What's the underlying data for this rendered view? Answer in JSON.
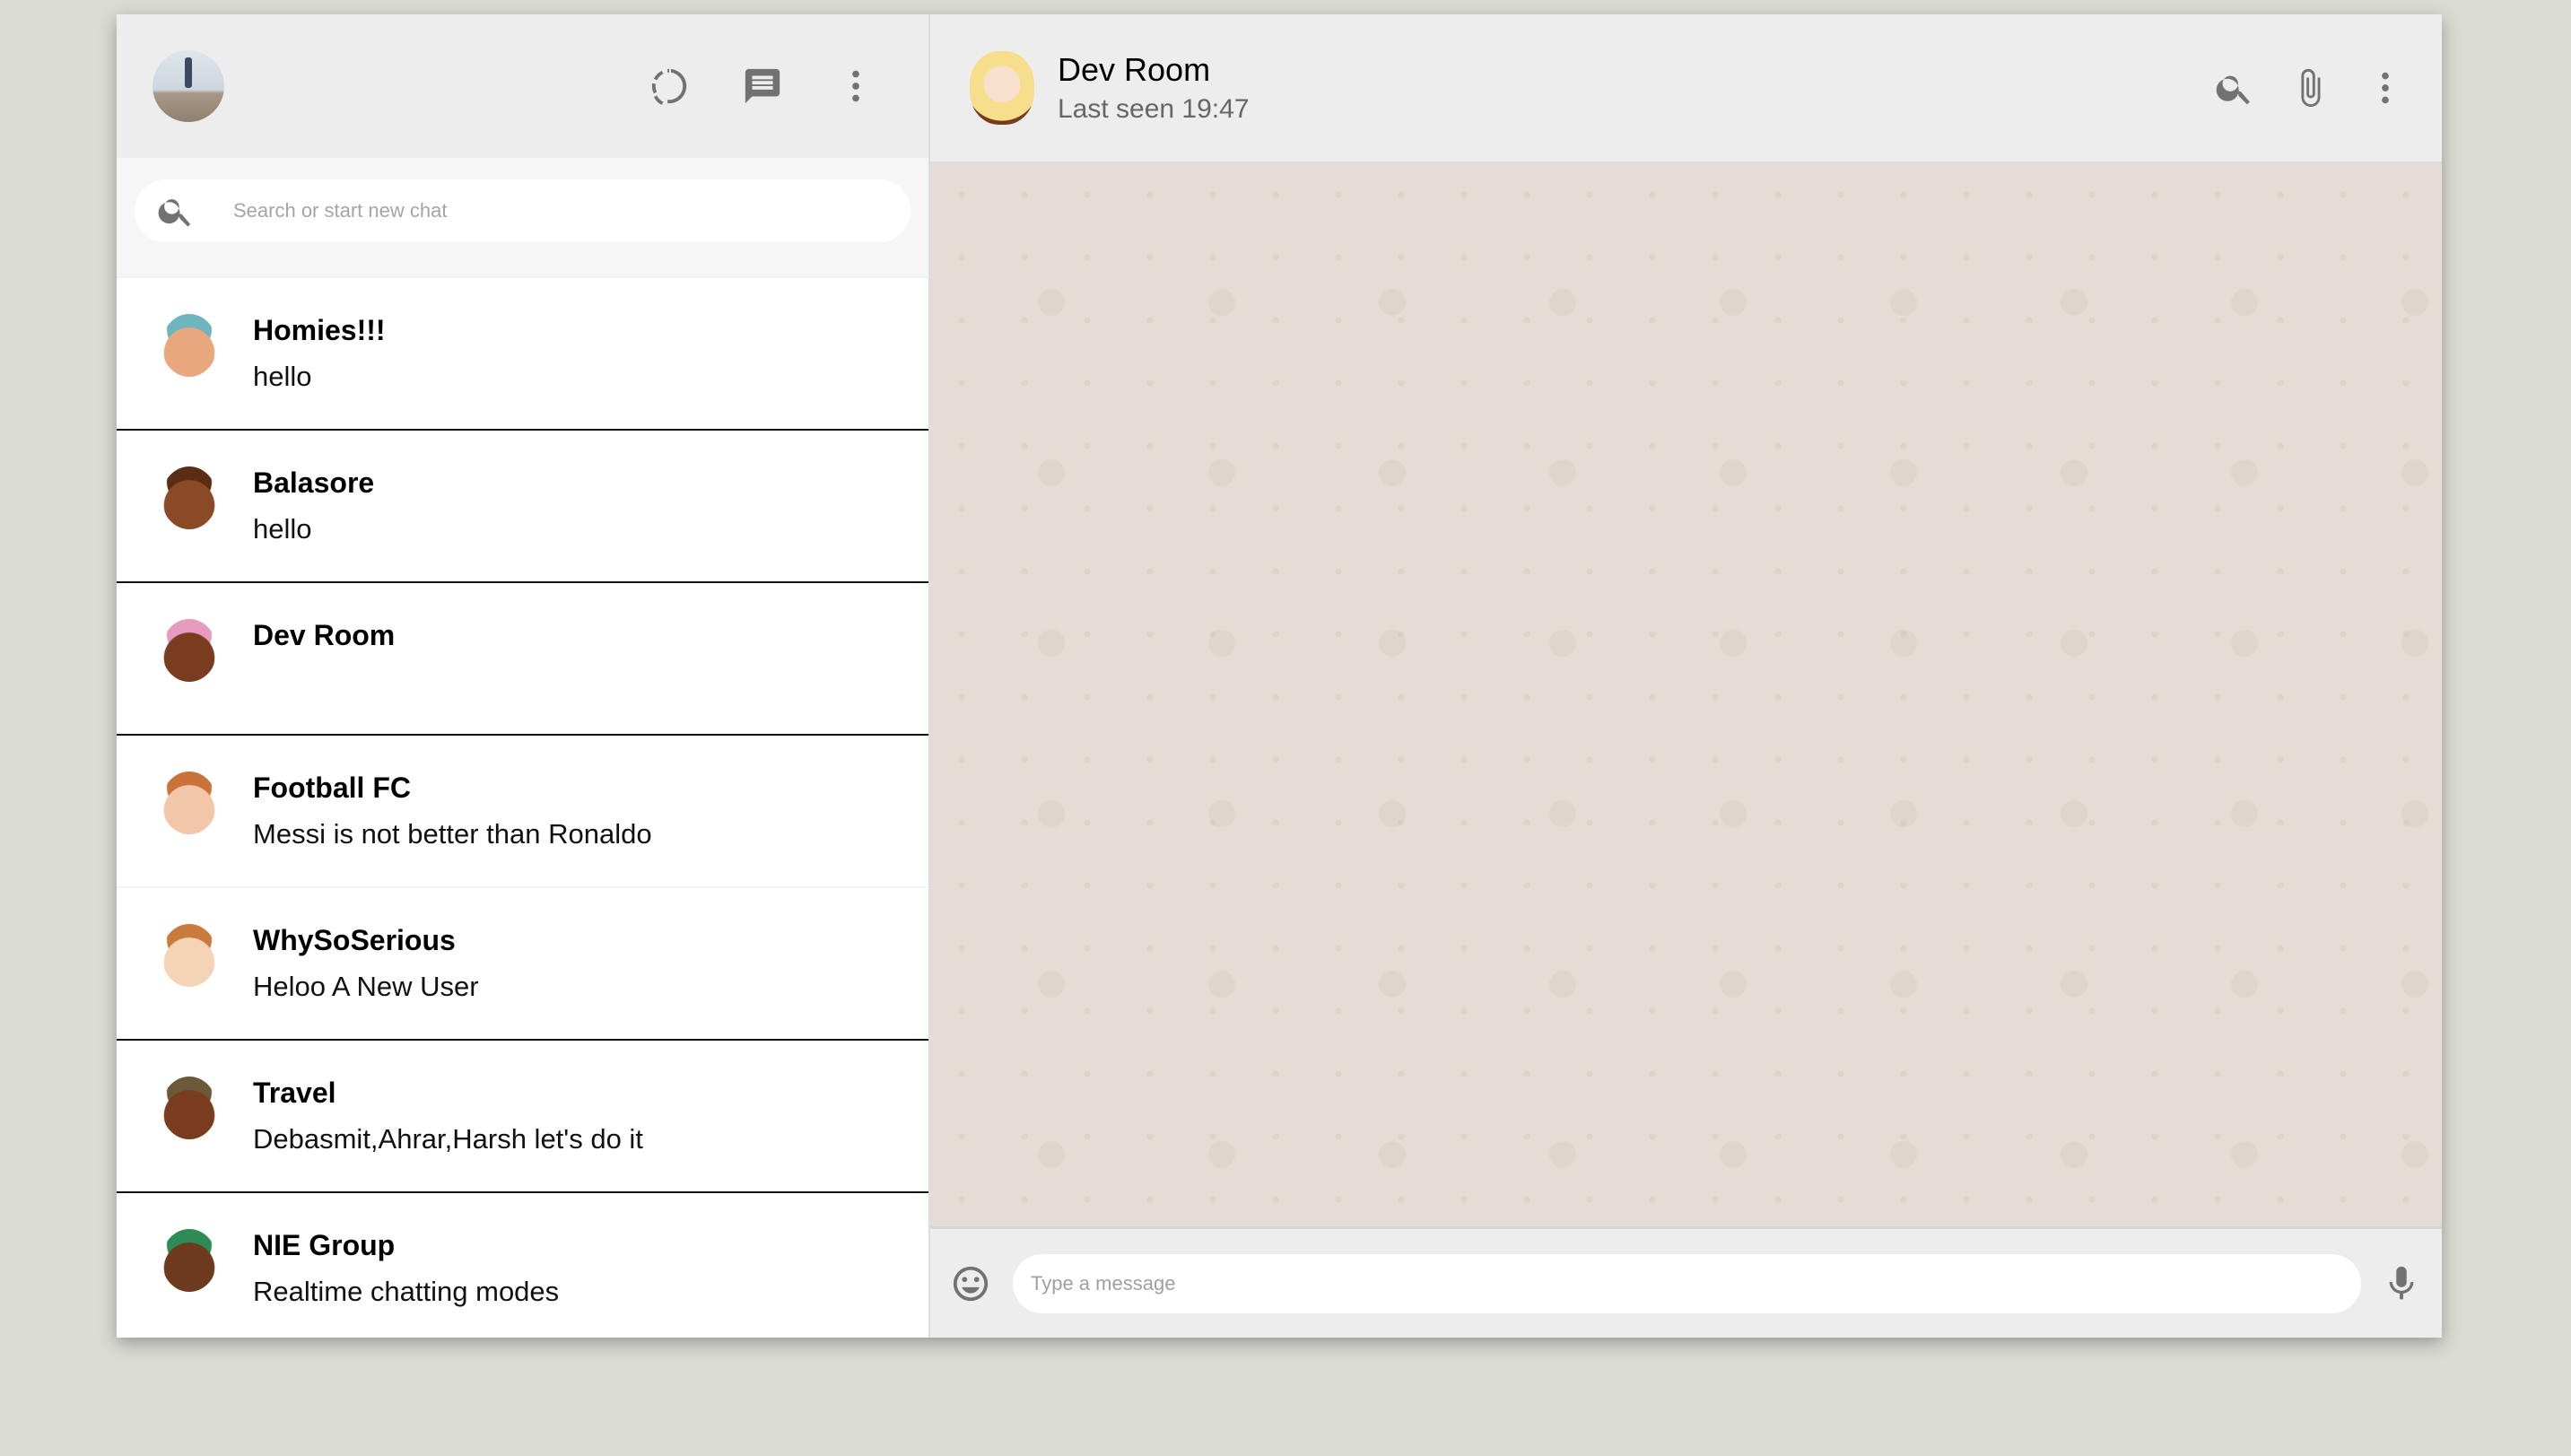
{
  "sidebar": {
    "search_placeholder": "Search or start new chat",
    "chats": [
      {
        "name": "Homies!!!",
        "last": "hello",
        "avatar_color": "#e8a77c",
        "hair": "#6fb5c0"
      },
      {
        "name": "Balasore",
        "last": "hello",
        "avatar_color": "#8a4a25",
        "hair": "#5a2d14"
      },
      {
        "name": "Dev Room",
        "last": "",
        "avatar_color": "#7a3c1e",
        "hair": "#e79bc0"
      },
      {
        "name": "Football FC",
        "last": "Messi is not better than Ronaldo",
        "avatar_color": "#f2c6a8",
        "hair": "#c9733b"
      },
      {
        "name": "WhySoSerious",
        "last": "Heloo A New User",
        "avatar_color": "#f5d3b7",
        "hair": "#c97a3d"
      },
      {
        "name": "Travel",
        "last": "Debasmit,Ahrar,Harsh let's do it",
        "avatar_color": "#7a3c1e",
        "hair": "#6b5a3a"
      },
      {
        "name": "NIE Group",
        "last": "Realtime chatting modes",
        "avatar_color": "#6d3a1d",
        "hair": "#2e8b57"
      }
    ]
  },
  "chat": {
    "title": "Dev Room",
    "subtitle": "Last seen 19:47",
    "input_placeholder": "Type a message"
  }
}
